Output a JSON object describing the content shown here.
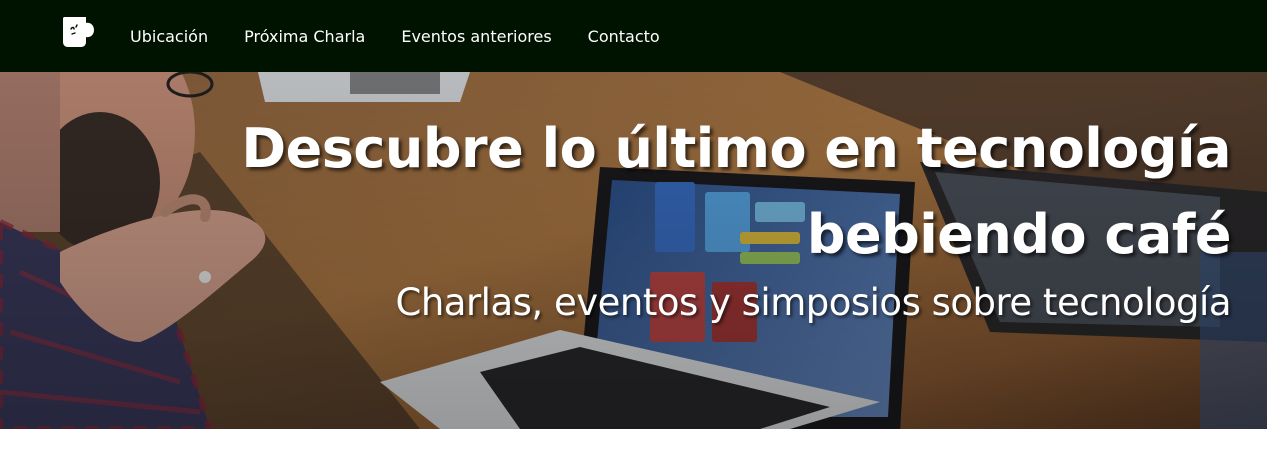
{
  "navbar": {
    "background": "#001300",
    "logo_icon": "coffee-cup-logo-icon",
    "links": [
      {
        "label": "Ubicación"
      },
      {
        "label": "Próxima Charla"
      },
      {
        "label": "Eventos anteriores"
      },
      {
        "label": "Contacto"
      }
    ]
  },
  "hero": {
    "title": "Descubre lo último en tecnología bebiendo café",
    "subtitle": "Charlas, eventos y simposios sobre tecnología",
    "background_image": "person-with-laptops-on-wooden-table"
  }
}
